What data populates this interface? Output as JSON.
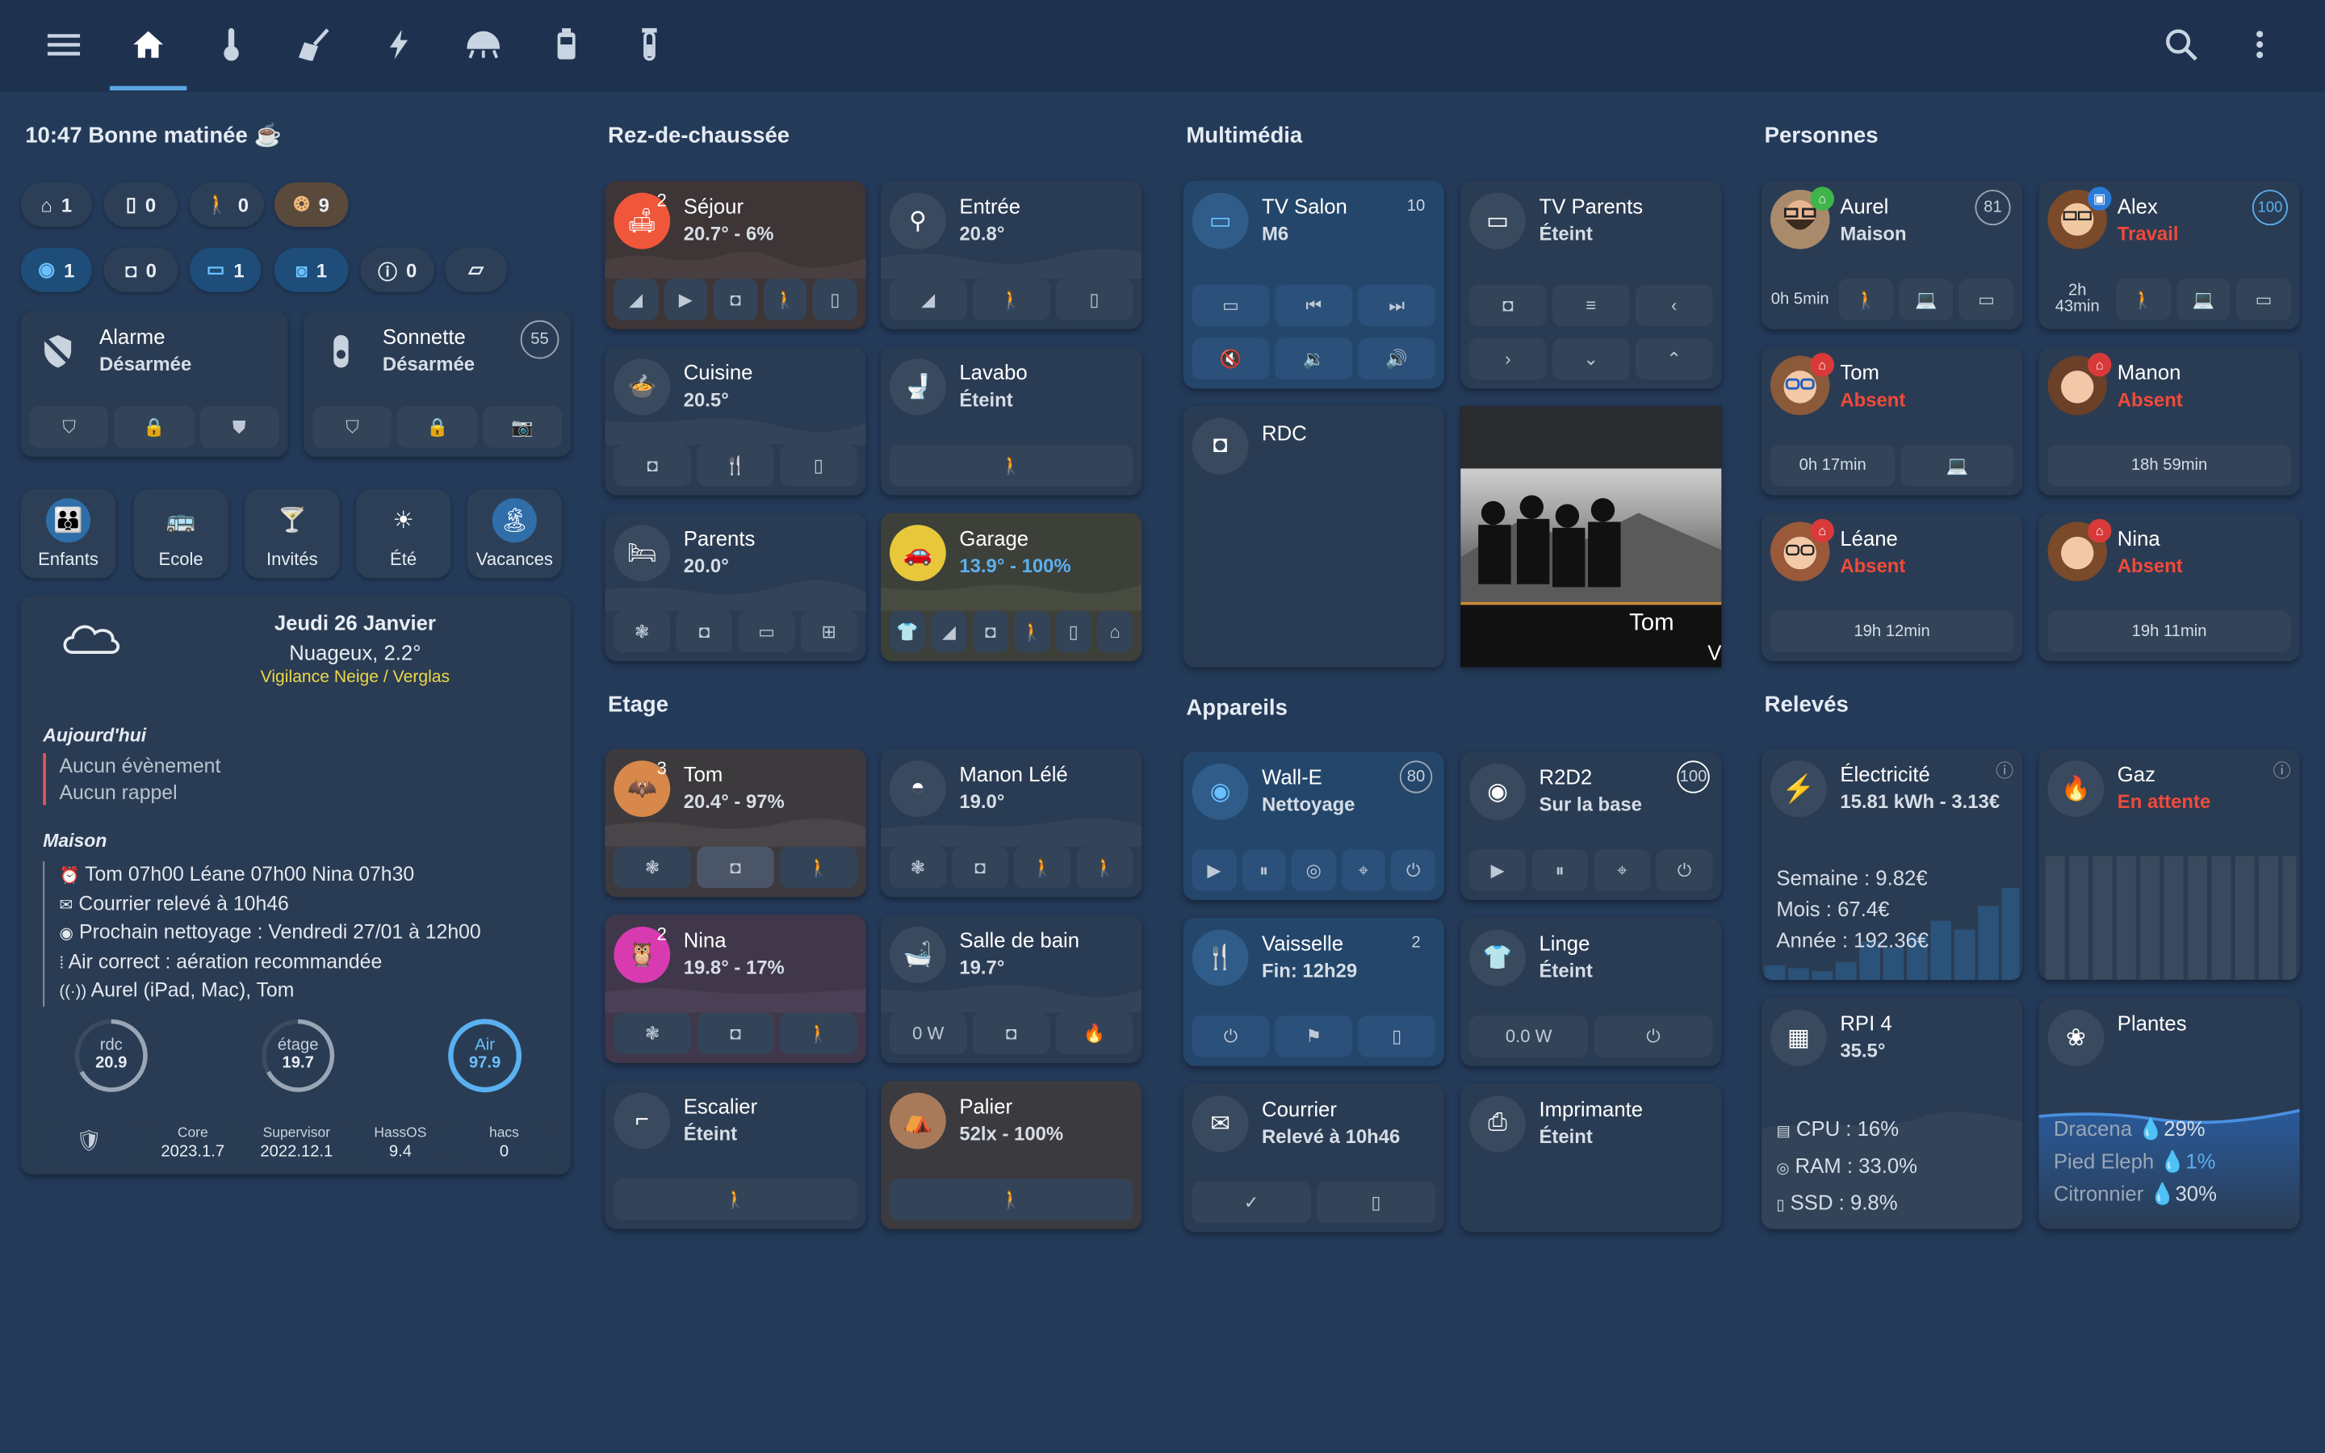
{
  "topbar": {
    "icons": [
      "menu-icon",
      "home-icon",
      "thermometer-icon",
      "broom-icon",
      "flash-icon",
      "fan-icon",
      "battery-icon",
      "test-tube-icon"
    ],
    "search": "search-icon",
    "more": "dots-vertical-icon"
  },
  "col1": {
    "greeting": "10:47 Bonne matinée ☕",
    "pills_row1": [
      {
        "icon": "home-icon",
        "value": "1"
      },
      {
        "icon": "door-icon",
        "value": "0"
      },
      {
        "icon": "person-icon",
        "value": "0"
      },
      {
        "icon": "ceiling-light-icon",
        "value": "9"
      }
    ],
    "pills_row2": [
      {
        "icon": "robot-vacuum-icon",
        "value": "1"
      },
      {
        "icon": "speaker-icon",
        "value": "0"
      },
      {
        "icon": "monitor-icon",
        "value": "1"
      },
      {
        "icon": "washing-machine-icon",
        "value": "1"
      },
      {
        "icon": "alert-icon",
        "value": "0"
      },
      {
        "icon": "tv-icon",
        "value": ""
      }
    ],
    "alarme": {
      "name": "Alarme",
      "state": "Désarmée"
    },
    "sonnette": {
      "name": "Sonnette",
      "state": "Désarmée",
      "badge": "55"
    },
    "modes": [
      {
        "label": "Enfants",
        "active": true
      },
      {
        "label": "Ecole",
        "active": false
      },
      {
        "label": "Invités",
        "active": false
      },
      {
        "label": "Été",
        "active": false
      },
      {
        "label": "Vacances",
        "active": true
      }
    ],
    "weather": {
      "date": "Jeudi 26 Janvier",
      "cond": "Nuageux, 2.2°",
      "alert": "Vigilance Neige / Verglas"
    },
    "today": {
      "title": "Aujourd'hui",
      "l1": "Aucun évènement",
      "l2": "Aucun rappel"
    },
    "maison": {
      "title": "Maison",
      "lines": [
        "Tom 07h00 Léane 07h00 Nina 07h30",
        "Courrier relevé à 10h46",
        "Prochain nettoyage : Vendredi 27/01 à 12h00",
        "Air correct : aération recommandée",
        "Aurel (iPad, Mac), Tom"
      ]
    },
    "gauges": [
      {
        "label": "rdc",
        "value": "20.9"
      },
      {
        "label": "étage",
        "value": "19.7"
      },
      {
        "label": "Air",
        "value": "97.9"
      }
    ],
    "versions": [
      {
        "label": "Core",
        "value": "2023.1.7"
      },
      {
        "label": "Supervisor",
        "value": "2022.12.1"
      },
      {
        "label": "HassOS",
        "value": "9.4"
      },
      {
        "label": "hacs",
        "value": "0"
      }
    ]
  },
  "col2": {
    "rdc_title": "Rez-de-chaussée",
    "etage_title": "Etage",
    "rooms": {
      "sejour": {
        "name": "Séjour",
        "state": "20.7° - 6%",
        "count": "2"
      },
      "entree": {
        "name": "Entrée",
        "state": "20.8°"
      },
      "cuisine": {
        "name": "Cuisine",
        "state": "20.5°"
      },
      "lavabo": {
        "name": "Lavabo",
        "state": "Éteint"
      },
      "parents": {
        "name": "Parents",
        "state": "20.0°"
      },
      "garage": {
        "name": "Garage",
        "state": "13.9° - 100%"
      },
      "tom": {
        "name": "Tom",
        "state": "20.4° - 97%",
        "count": "3"
      },
      "manon": {
        "name": "Manon Lélé",
        "state": "19.0°"
      },
      "nina": {
        "name": "Nina",
        "state": "19.8° - 17%",
        "count": "2"
      },
      "sdb": {
        "name": "Salle de bain",
        "state": "19.7°",
        "power": "0 W"
      },
      "escalier": {
        "name": "Escalier",
        "state": "Éteint"
      },
      "palier": {
        "name": "Palier",
        "state": "52lx - 100%"
      }
    }
  },
  "col3": {
    "media_title": "Multimédia",
    "app_title": "Appareils",
    "tv_salon": {
      "name": "TV Salon",
      "state": "M6",
      "badge": "10"
    },
    "tv_parents": {
      "name": "TV Parents",
      "state": "Éteint"
    },
    "rdc": {
      "name": "RDC"
    },
    "album": {
      "artist": "Tom",
      "extra": "V"
    },
    "walle": {
      "name": "Wall-E",
      "state": "Nettoyage",
      "badge": "80"
    },
    "r2d2": {
      "name": "R2D2",
      "state": "Sur la base",
      "badge": "100"
    },
    "vaisselle": {
      "name": "Vaisselle",
      "state": "Fin: 12h29",
      "badge": "2"
    },
    "linge": {
      "name": "Linge",
      "state": "Éteint",
      "power": "0.0 W"
    },
    "courrier": {
      "name": "Courrier",
      "state": "Relevé à 10h46"
    },
    "imprimante": {
      "name": "Imprimante",
      "state": "Éteint"
    }
  },
  "col4": {
    "people_title": "Personnes",
    "releves_title": "Relevés",
    "people": [
      {
        "name": "Aurel",
        "state": "Maison",
        "badge": "81",
        "time": "0h 5min"
      },
      {
        "name": "Alex",
        "state": "Travail",
        "badge": "100",
        "time": "2h 43min"
      },
      {
        "name": "Tom",
        "state": "Absent",
        "time": "0h 17min"
      },
      {
        "name": "Manon",
        "state": "Absent",
        "time": "18h 59min"
      },
      {
        "name": "Léane",
        "state": "Absent",
        "time": "19h 12min"
      },
      {
        "name": "Nina",
        "state": "Absent",
        "time": "19h 11min"
      }
    ],
    "elec": {
      "name": "Électricité",
      "state": "15.81 kWh - 3.13€",
      "semaine": "Semaine : 9.82€",
      "mois": "Mois : 67.4€",
      "annee": "Année : 192.36€"
    },
    "gaz": {
      "name": "Gaz",
      "state": "En attente"
    },
    "rpi": {
      "name": "RPI 4",
      "state": "35.5°",
      "cpu": "CPU : 16%",
      "ram": "RAM : 33.0%",
      "ssd": "SSD : 9.8%"
    },
    "plantes": {
      "name": "Plantes",
      "p1": "Dracena",
      "v1": "29%",
      "p2": "Pied Eleph",
      "v2": "1%",
      "p3": "Citronnier",
      "v3": "30%"
    }
  },
  "colors": {
    "accent": "#5aa6e0",
    "red": "#f04a3a",
    "yellow": "#e8d440",
    "bg": "#243a59",
    "card": "#2a3c53"
  }
}
